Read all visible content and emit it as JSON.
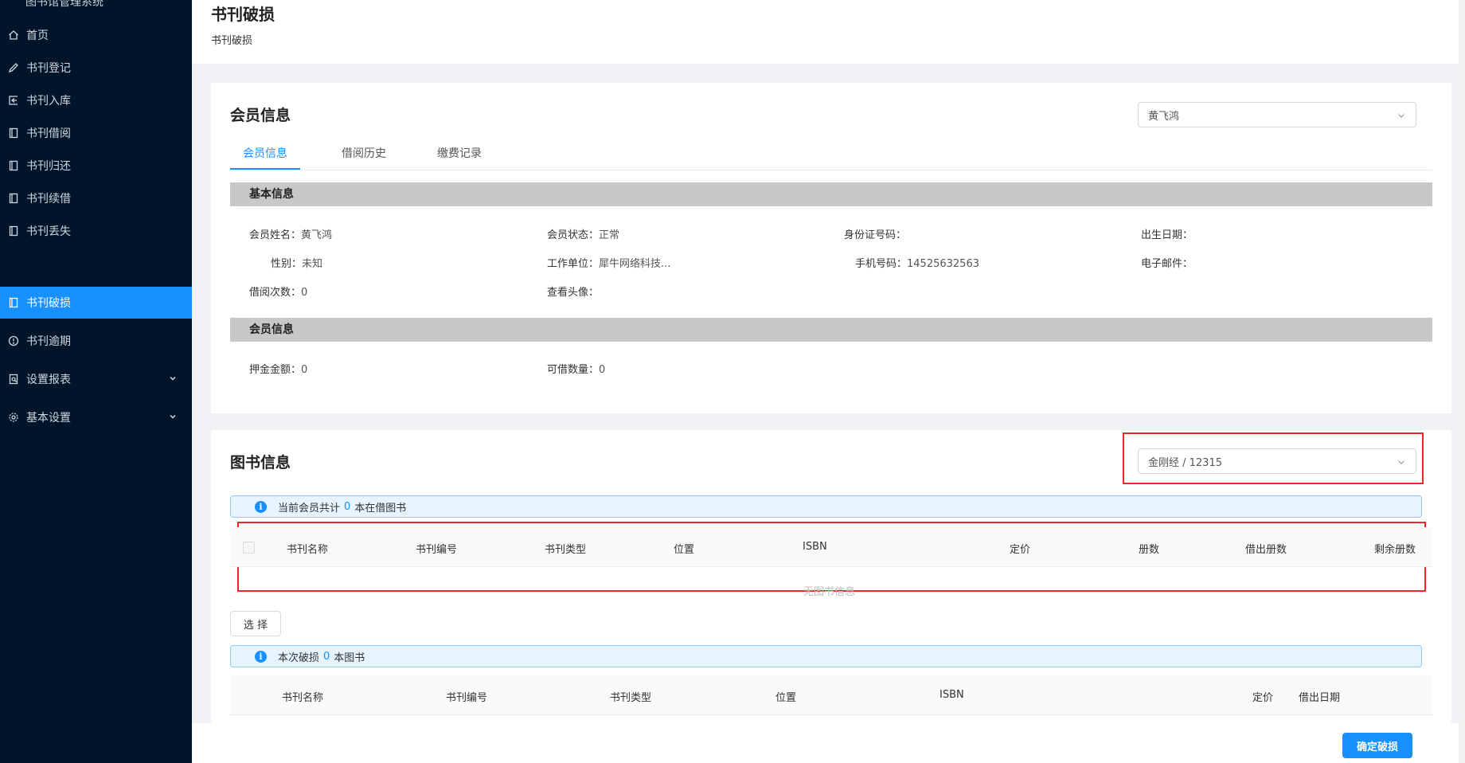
{
  "sidebar": {
    "top_partial": "图书馆管理系统",
    "items": [
      {
        "label": "首页",
        "icon": "home-icon"
      },
      {
        "label": "书刊登记",
        "icon": "edit-icon"
      },
      {
        "label": "书刊入库",
        "icon": "import-icon"
      },
      {
        "label": "书刊借阅",
        "icon": "book-icon"
      },
      {
        "label": "书刊归还",
        "icon": "book-icon"
      },
      {
        "label": "书刊续借",
        "icon": "book-icon"
      },
      {
        "label": "书刊丢失",
        "icon": "book-icon"
      },
      {
        "label": "书刊破损",
        "icon": "book-icon",
        "active": true
      },
      {
        "label": "书刊逾期",
        "icon": "clock-icon"
      },
      {
        "label": "设置报表",
        "icon": "report-icon",
        "expandable": true
      },
      {
        "label": "基本设置",
        "icon": "gear-icon",
        "expandable": true
      }
    ]
  },
  "header": {
    "title": "书刊破损",
    "breadcrumb": "书刊破损"
  },
  "member_card": {
    "title": "会员信息",
    "selected_member": "黄飞鸿",
    "tabs": [
      "会员信息",
      "借阅历史",
      "缴费记录"
    ],
    "active_tab": "会员信息",
    "basic_section": "基本信息",
    "fields": {
      "name_label": "会员姓名：",
      "name": "黄飞鸿",
      "status_label": "会员状态：",
      "status": "正常",
      "id_label": "身份证号码：",
      "id": "",
      "birth_label": "出生日期：",
      "birth": "",
      "gender_label": "性别：",
      "gender": "未知",
      "company_label": "工作单位：",
      "company": "犀牛网络科技...",
      "phone_label": "手机号码：",
      "phone": "14525632563",
      "email_label": "电子邮件：",
      "email": "",
      "borrow_count_label": "借阅次数：",
      "borrow_count": "0",
      "avatar_label": "查看头像：",
      "avatar": ""
    },
    "member_section": "会员信息",
    "member_fields": {
      "deposit_label": "押金金额：",
      "deposit": "0",
      "borrowable_label": "可借数量：",
      "borrowable": "0"
    }
  },
  "book_card": {
    "title": "图书信息",
    "selected_book": "金刚经 / 12315",
    "alert1": {
      "prefix": "当前会员共计",
      "count": "0",
      "suffix": "本在借图书"
    },
    "table1": {
      "columns": [
        "书刊名称",
        "书刊编号",
        "书刊类型",
        "位置",
        "ISBN",
        "定价",
        "册数",
        "借出册数",
        "剩余册数"
      ],
      "empty_text": "无图书信息"
    },
    "select_button": "选 择",
    "alert2": {
      "prefix": "本次破损",
      "count": "0",
      "suffix": "本图书"
    },
    "table2": {
      "columns": [
        "书刊名称",
        "书刊编号",
        "书刊类型",
        "位置",
        "ISBN",
        "定价",
        "借出日期"
      ]
    }
  },
  "footer": {
    "confirm": "确定破损"
  },
  "colors": {
    "sidebar_bg": "#001529",
    "accent": "#1890ff",
    "highlight": "#e8272b"
  }
}
